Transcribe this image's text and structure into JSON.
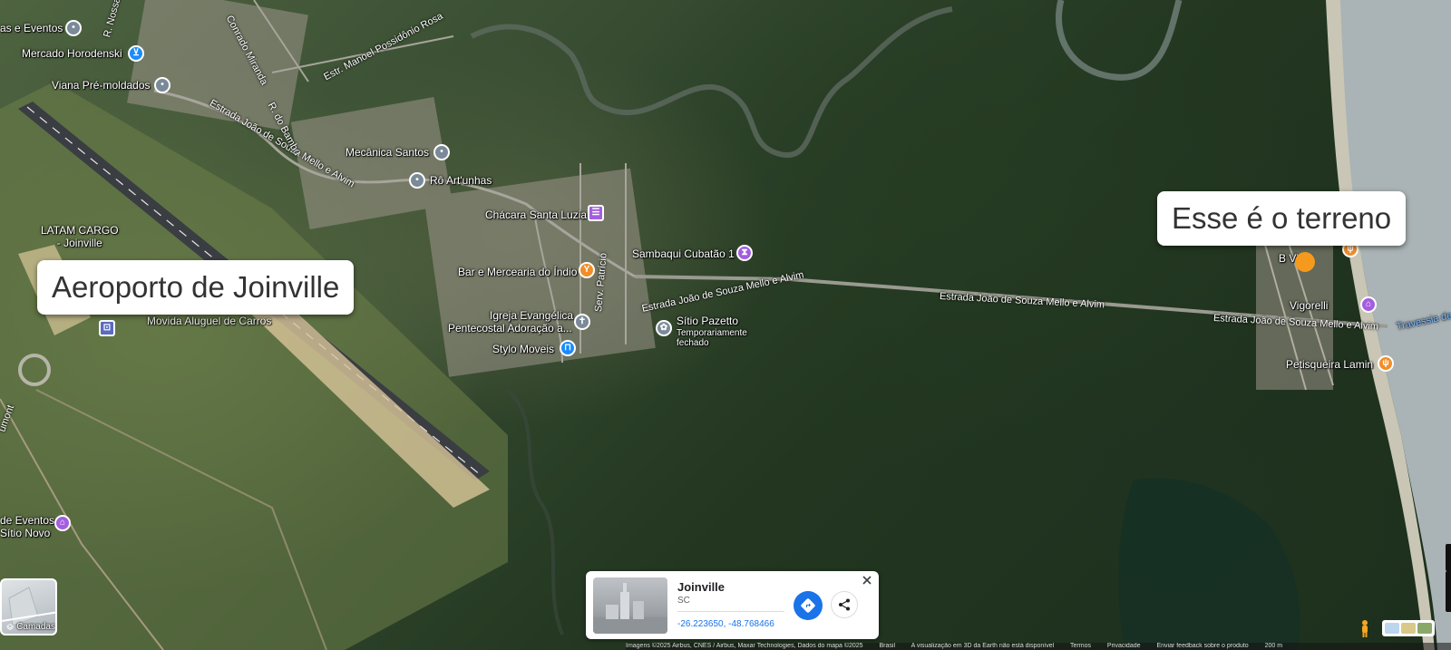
{
  "callouts": {
    "airport": "Aeroporto de Joinville",
    "land": "Esse é o terreno"
  },
  "pois": [
    {
      "label": "as e Eventos",
      "icon": "pin-icon",
      "color": "#7b8a99"
    },
    {
      "label": "Mercado Horodenski",
      "icon": "shopping-cart-icon",
      "color": "#1a8cff"
    },
    {
      "label": "Viana Pré-moldados",
      "icon": "pin-icon",
      "color": "#7b8a99"
    },
    {
      "label": "Mecânica Santos",
      "icon": "pin-icon",
      "color": "#7b8a99"
    },
    {
      "label": "Rô Art'unhas",
      "icon": "pin-icon",
      "color": "#7b8a99"
    },
    {
      "label": "Chácara Santa Luzia",
      "icon": "event-venue-icon",
      "color": "#a45de0"
    },
    {
      "label": "Sambaqui Cubatão 1",
      "icon": "monument-icon",
      "color": "#a45de0"
    },
    {
      "label": "Bar e Mercearia do Índio",
      "icon": "cocktail-icon",
      "color": "#f08e2a"
    },
    {
      "label": "LATAM CARGO\n- Joinville",
      "icon": "",
      "color": ""
    },
    {
      "label": "Movida Aluguel de Carros",
      "icon": "car-rental-icon",
      "color": "#5c6bc0"
    },
    {
      "label": "Igreja Evangélica",
      "icon": "church-icon",
      "color": "#7b8a99"
    },
    {
      "label": "Pentecostal Adoração a...",
      "icon": "",
      "color": ""
    },
    {
      "label": "Sítio Pazetto",
      "icon": "flower-icon",
      "color": "#7b8a99"
    },
    {
      "label": "Temporariamente",
      "icon": "",
      "color": ""
    },
    {
      "label": "fechado",
      "icon": "",
      "color": ""
    },
    {
      "label": "Stylo Moveis",
      "icon": "lock-icon",
      "color": "#1a8cff"
    },
    {
      "label": "de Eventos",
      "icon": "house-icon",
      "color": "#a45de0"
    },
    {
      "label": "Sítio Novo",
      "icon": "",
      "color": ""
    },
    {
      "label": "B  Vista",
      "icon": "restaurant-icon",
      "color": "#f08e2a"
    },
    {
      "label": "Vigorelli",
      "icon": "lodging-icon",
      "color": "#a45de0"
    },
    {
      "label": "Petisqueira Lamin",
      "icon": "restaurant-icon",
      "color": "#f08e2a"
    }
  ],
  "roads": [
    "R. Nossa",
    "Conrado Miranda",
    "Estr. Manoel Possidônio Rosa",
    "Estrada João de Souza Mello e Alvim",
    "R. do Bambu",
    "Serv. Patrício",
    "Travessia de",
    "umont"
  ],
  "info_card": {
    "title": "Joinville",
    "subtitle": "SC",
    "coords": "-26.223650, -48.768466",
    "directions_icon": "directions-icon",
    "share_icon": "share-icon",
    "close_icon": "close-icon"
  },
  "layers": {
    "label": "Camadas",
    "icon": "layers-icon"
  },
  "footer": {
    "imagery": "Imagens ©2025 Airbus, CNES / Airbus, Maxar Technologies, Dados do mapa ©2025",
    "country": "Brasil",
    "notice": "A visualização em 3D da Earth não está disponível",
    "terms": "Termos",
    "privacy": "Privacidade",
    "feedback": "Enviar feedback sobre o produto",
    "scale": "200 m"
  },
  "colors": {
    "marker": "#f59a1c",
    "link_blue": "#1a73e8",
    "road": "#9a9a90"
  }
}
